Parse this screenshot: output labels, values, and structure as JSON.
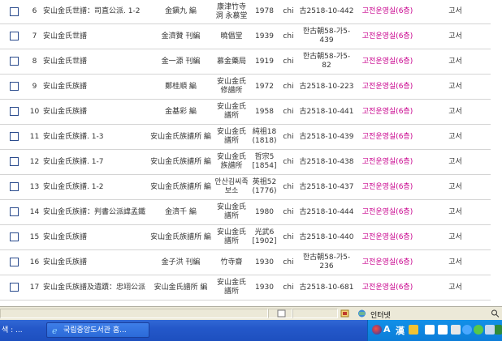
{
  "rows": [
    {
      "num": "6",
      "title": "安山金氏世譜：司直公派. 1-2",
      "author": "金鎭九 編",
      "publisher": "康津竹寺洞 永慕堂",
      "year": "1978",
      "lang": "chi",
      "call": "古2518-10-442",
      "loc": "고전운영실(6층)",
      "type": "고서"
    },
    {
      "num": "7",
      "title": "安山金氏世譜",
      "author": "金濟贊 刊編",
      "publisher": "曉倡堂",
      "year": "1939",
      "lang": "chi",
      "call": "한古朝58-가5-439",
      "loc": "고전운영실(6층)",
      "type": "고서"
    },
    {
      "num": "8",
      "title": "安山金氏世譜",
      "author": "金一源 刊編",
      "publisher": "慕金藥局",
      "year": "1919",
      "lang": "chi",
      "call": "한古朝58-가5-82",
      "loc": "고전운영실(6층)",
      "type": "고서"
    },
    {
      "num": "9",
      "title": "安山金氏族譜",
      "author": "鄭桂順 編",
      "publisher": "安山金氏修譜所",
      "year": "1972",
      "lang": "chi",
      "call": "古2518-10-223",
      "loc": "고전운영실(6층)",
      "type": "고서"
    },
    {
      "num": "10",
      "title": "安山金氏族譜",
      "author": "金基彩 編",
      "publisher": "安山金氏譜所",
      "year": "1958",
      "lang": "chi",
      "call": "古2518-10-441",
      "loc": "고전운영실(6층)",
      "type": "고서"
    },
    {
      "num": "11",
      "title": "安山金氏族譜. 1-3",
      "author": "安山金氏族譜所 編",
      "publisher": "安山金氏譜所",
      "year": "純祖18 (1818)",
      "lang": "chi",
      "call": "古2518-10-439",
      "loc": "고전운영실(6층)",
      "type": "고서"
    },
    {
      "num": "12",
      "title": "安山金氏族譜. 1-7",
      "author": "安山金氏族譜所 編",
      "publisher": "安山金氏族譜所",
      "year": "哲宗5 [1854]",
      "lang": "chi",
      "call": "古2518-10-438",
      "loc": "고전운영실(6층)",
      "type": "고서"
    },
    {
      "num": "13",
      "title": "安山金氏族譜. 1-2",
      "author": "安山金氏族譜所 編",
      "publisher": "안산김씨족보소",
      "year": "英祖52 (1776)",
      "lang": "chi",
      "call": "古2518-10-437",
      "loc": "고전운영실(6층)",
      "type": "고서"
    },
    {
      "num": "14",
      "title": "安山金氏族譜：判書公派諱孟鐵",
      "author": "金濟千 編",
      "publisher": "安山金氏譜所",
      "year": "1980",
      "lang": "chi",
      "call": "古2518-10-444",
      "loc": "고전운영실(6층)",
      "type": "고서"
    },
    {
      "num": "15",
      "title": "安山金氏族譜",
      "author": "安山金氏族譜所 編",
      "publisher": "安山金氏譜所",
      "year": "光武6 [1902]",
      "lang": "chi",
      "call": "古2518-10-440",
      "loc": "고전운영실(6층)",
      "type": "고서"
    },
    {
      "num": "16",
      "title": "安山金氏族譜",
      "author": "金子洪 刊編",
      "publisher": "竹寺齋",
      "year": "1930",
      "lang": "chi",
      "call": "한古朝58-가5-236",
      "loc": "고전운영실(6층)",
      "type": "고서"
    },
    {
      "num": "17",
      "title": "安山金氏族譜及遺蹟：忠翊公派",
      "author": "安山金氏譜所 編",
      "publisher": "安山金氏譜所",
      "year": "1930",
      "lang": "chi",
      "call": "古2518-10-681",
      "loc": "고전운영실(6층)",
      "type": "고서"
    }
  ],
  "statusbar": {
    "zone": "인터넷"
  },
  "taskbar": {
    "left_text": "색 : ...",
    "window_button": "국립중앙도서관 홈..."
  },
  "tray": {
    "ime_a": "A",
    "ime_han": "漢"
  },
  "colors": {
    "location": "#c8008c",
    "taskbar": "#2458c9",
    "tray": "#0c7dd8"
  },
  "icons": [
    "checkbox",
    "page-icon",
    "lock-icon",
    "internet-globe-icon",
    "ie-icon",
    "zoom-icon",
    "tray-icons"
  ]
}
